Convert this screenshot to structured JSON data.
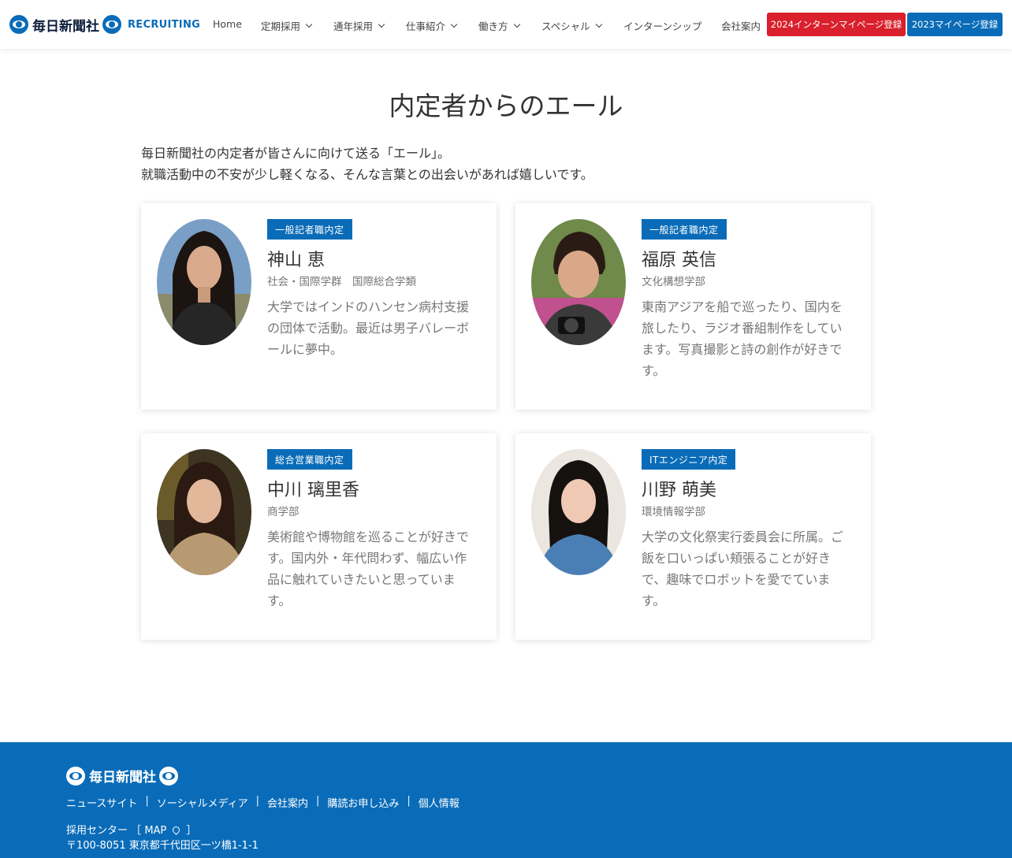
{
  "header": {
    "brand_name": "毎日新聞社",
    "brand_sub": "RECRUITING",
    "nav": [
      {
        "label": "Home"
      },
      {
        "label": "定期採用"
      },
      {
        "label": "通年採用"
      },
      {
        "label": "仕事紹介"
      },
      {
        "label": "働き方"
      },
      {
        "label": "スペシャル"
      },
      {
        "label": "インターンシップ"
      },
      {
        "label": "会社案内"
      }
    ],
    "btn_2024": "2024インターンマイページ登録",
    "btn_2023": "2023マイページ登録"
  },
  "main": {
    "title": "内定者からのエール",
    "intro_line1": "毎日新聞社の内定者が皆さんに向けて送る「エール」。",
    "intro_line2": "就職活動中の不安が少し軽くなる、そんな言葉との出会いがあれば嬉しいです。",
    "cards": [
      {
        "badge": "一般記者職内定",
        "name": "神山 恵",
        "dept": "社会・国際学群　国際総合学類",
        "desc": "大学ではインドのハンセン病村支援の団体で活動。最近は男子バレーボールに夢中。"
      },
      {
        "badge": "一般記者職内定",
        "name": "福原 英信",
        "dept": "文化構想学部",
        "desc": "東南アジアを船で巡ったり、国内を旅したり、ラジオ番組制作をしています。写真撮影と詩の創作が好きです。"
      },
      {
        "badge": "総合営業職内定",
        "name": "中川 璃里香",
        "dept": "商学部",
        "desc": "美術館や博物館を巡ることが好きです。国内外・年代問わず、幅広い作品に触れていきたいと思っています。"
      },
      {
        "badge": "ITエンジニア内定",
        "name": "川野 萌美",
        "dept": "環境情報学部",
        "desc": "大学の文化祭実行委員会に所属。ご飯を口いっぱい頬張ることが好きで、趣味でロボットを愛でています。"
      }
    ]
  },
  "footer": {
    "brand_name": "毎日新聞社",
    "links": [
      "ニュースサイト",
      "ソーシャルメディア",
      "会社案内",
      "購読お申し込み",
      "個人情報"
    ],
    "center_label": "採用センター",
    "map_label": "MAP",
    "address": "〒100-8051 東京都千代田区一ツ橋1-1-1"
  },
  "colors": {
    "brand_blue": "#0a6cb8",
    "accent_red": "#d9202c"
  },
  "icons": [
    "eye-logo-icon",
    "chevron-down-icon",
    "map-pin-icon"
  ]
}
